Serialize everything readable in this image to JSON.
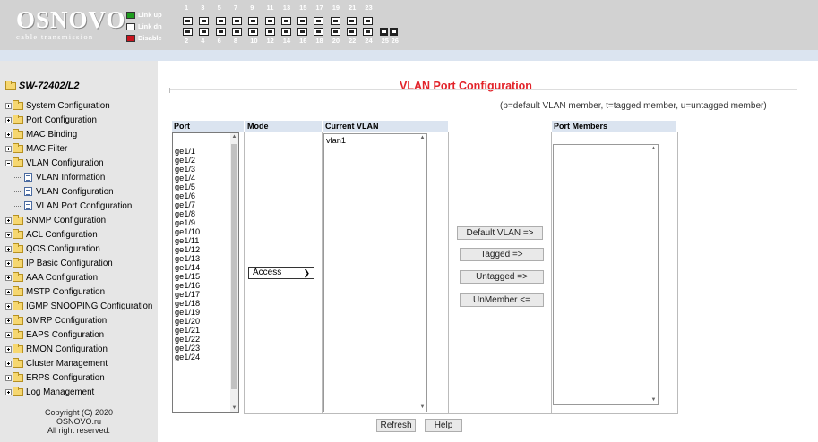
{
  "header": {
    "logo_main": "OSNOVO",
    "logo_sub": "cable transmission",
    "legend": [
      {
        "label": "Link up",
        "color": "#1e9c1e"
      },
      {
        "label": "Link dn",
        "color": "#ffffff"
      },
      {
        "label": "Disable",
        "color": "#c8141e"
      }
    ],
    "port_numbers_top": [
      "1",
      "3",
      "5",
      "7",
      "9",
      "11",
      "13",
      "15",
      "17",
      "19",
      "21",
      "23"
    ],
    "port_numbers_bottom": [
      "2",
      "4",
      "6",
      "8",
      "10",
      "12",
      "14",
      "16",
      "18",
      "20",
      "22",
      "24",
      "25",
      "26"
    ]
  },
  "sidebar": {
    "root": "SW-72402/L2",
    "items": [
      {
        "label": "System Configuration",
        "icon": "folder-icon"
      },
      {
        "label": "Port Configuration",
        "icon": "folder-icon"
      },
      {
        "label": "MAC Binding",
        "icon": "folder-icon"
      },
      {
        "label": "MAC Filter",
        "icon": "folder-icon"
      },
      {
        "label": "VLAN Configuration",
        "icon": "folder-open-icon",
        "expanded": true,
        "children": [
          "VLAN Information",
          "VLAN Configuration",
          "VLAN Port Configuration"
        ]
      },
      {
        "label": "SNMP Configuration",
        "icon": "folder-icon"
      },
      {
        "label": "ACL Configuration",
        "icon": "folder-icon"
      },
      {
        "label": "QOS Configuration",
        "icon": "folder-icon"
      },
      {
        "label": "IP Basic Configuration",
        "icon": "folder-icon"
      },
      {
        "label": "AAA Configuration",
        "icon": "folder-icon"
      },
      {
        "label": "MSTP Configuration",
        "icon": "folder-icon"
      },
      {
        "label": "IGMP SNOOPING Configuration",
        "icon": "folder-icon"
      },
      {
        "label": "GMRP Configuration",
        "icon": "folder-icon"
      },
      {
        "label": "EAPS Configuration",
        "icon": "folder-icon"
      },
      {
        "label": "RMON Configuration",
        "icon": "folder-icon"
      },
      {
        "label": "Cluster Management",
        "icon": "folder-icon"
      },
      {
        "label": "ERPS Configuration",
        "icon": "folder-icon"
      },
      {
        "label": "Log Management",
        "icon": "folder-icon"
      }
    ],
    "copyright": [
      "Copyright (C) 2020",
      "OSNOVO.ru",
      "All right reserved."
    ]
  },
  "main": {
    "title": "VLAN Port Configuration",
    "note": "(p=default VLAN member, t=tagged member, u=untagged member)",
    "columns": {
      "port": "Port",
      "mode": "Mode",
      "current_vlan": "Current VLAN",
      "port_members": "Port Members"
    },
    "ports": [
      "ge1/1",
      "ge1/2",
      "ge1/3",
      "ge1/4",
      "ge1/5",
      "ge1/6",
      "ge1/7",
      "ge1/8",
      "ge1/9",
      "ge1/10",
      "ge1/11",
      "ge1/12",
      "ge1/13",
      "ge1/14",
      "ge1/15",
      "ge1/16",
      "ge1/17",
      "ge1/18",
      "ge1/19",
      "ge1/20",
      "ge1/21",
      "ge1/22",
      "ge1/23",
      "ge1/24"
    ],
    "mode_selected": "Access",
    "current_vlans": [
      "vlan1"
    ],
    "port_members": [],
    "actions": {
      "default_vlan": "Default  VLAN =>",
      "tagged": "Tagged =>",
      "untagged": "Untagged =>",
      "unmember": "UnMember <="
    },
    "buttons": {
      "refresh": "Refresh",
      "help": "Help"
    }
  }
}
